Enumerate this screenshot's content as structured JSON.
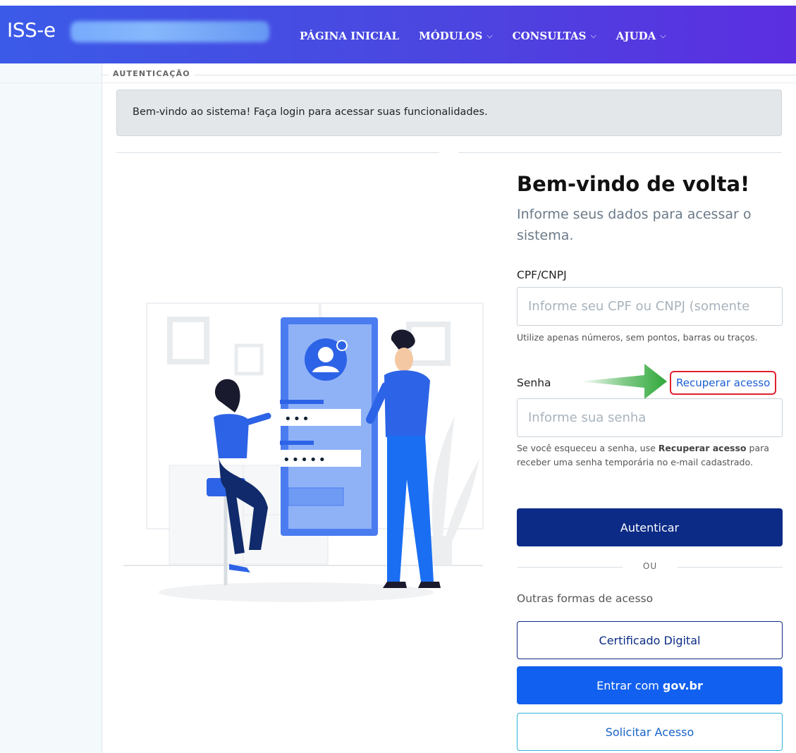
{
  "header": {
    "brand": "ISS-e",
    "nav": [
      {
        "label": "PÁGINA INICIAL",
        "dropdown": false
      },
      {
        "label": "MÓDULOS",
        "dropdown": true
      },
      {
        "label": "CONSULTAS",
        "dropdown": true
      },
      {
        "label": "AJUDA",
        "dropdown": true
      }
    ],
    "chevron": "⌵"
  },
  "section": {
    "legend": "AUTENTICAÇÃO",
    "alert": "Bem-vindo ao sistema! Faça login para acessar suas funcionalidades."
  },
  "login": {
    "title": "Bem-vindo de volta!",
    "subtitle": "Informe seus dados para acessar o sistema.",
    "cpf_label": "CPF/CNPJ",
    "cpf_placeholder": "Informe seu CPF ou CNPJ (somente",
    "cpf_help": "Utilize apenas números, sem pontos, barras ou traços.",
    "senha_label": "Senha",
    "recover_link": "Recuperar acesso",
    "senha_placeholder": "Informe sua senha",
    "senha_help_pre": "Se você esqueceu a senha, use ",
    "senha_help_bold": "Recuperar acesso",
    "senha_help_post": " para receber uma senha temporária no e-mail cadastrado.",
    "submit": "Autenticar",
    "or": "OU",
    "other_label": "Outras formas de acesso",
    "cert_button": "Certificado Digital",
    "gov_button_pre": "Entrar com",
    "gov_button_bold": "gov.br",
    "request_button": "Solicitar Acesso"
  },
  "illustration": {
    "password_dots_1": "•••",
    "password_dots_2": "•••••"
  },
  "colors": {
    "primary": "#0c2b86",
    "gov": "#1160ef",
    "link": "#1a5fd1",
    "highlight": "#e0212f",
    "arrow": "#2fa83a"
  }
}
